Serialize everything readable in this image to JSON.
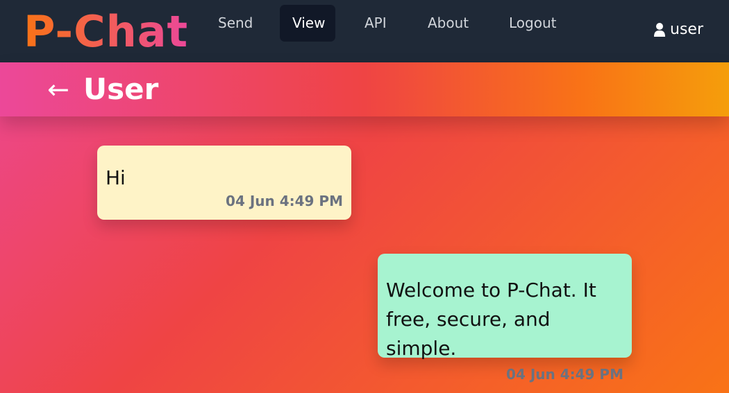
{
  "app": {
    "logo_text": "P-Chat",
    "colors": {
      "navbar_bg": "#1f2937",
      "active_tab_bg": "#111827",
      "incoming_bubble": "#fef3c7",
      "outgoing_bubble": "#a7f3d0",
      "timestamp": "#6b7280"
    }
  },
  "nav": {
    "items": [
      {
        "label": "Send"
      },
      {
        "label": "View",
        "active": true
      },
      {
        "label": "API"
      },
      {
        "label": "About"
      },
      {
        "label": "Logout"
      }
    ],
    "user": {
      "icon": "user-icon",
      "label": "user"
    }
  },
  "chat": {
    "back_icon": "back-arrow-icon",
    "back_glyph": "←",
    "title": "User",
    "messages": [
      {
        "direction": "incoming",
        "text": "Hi",
        "time": "04 Jun 4:49 PM"
      },
      {
        "direction": "outgoing",
        "text": "Welcome to P-Chat. It free, secure, and simple.",
        "time": "04 Jun 4:49 PM"
      }
    ]
  }
}
